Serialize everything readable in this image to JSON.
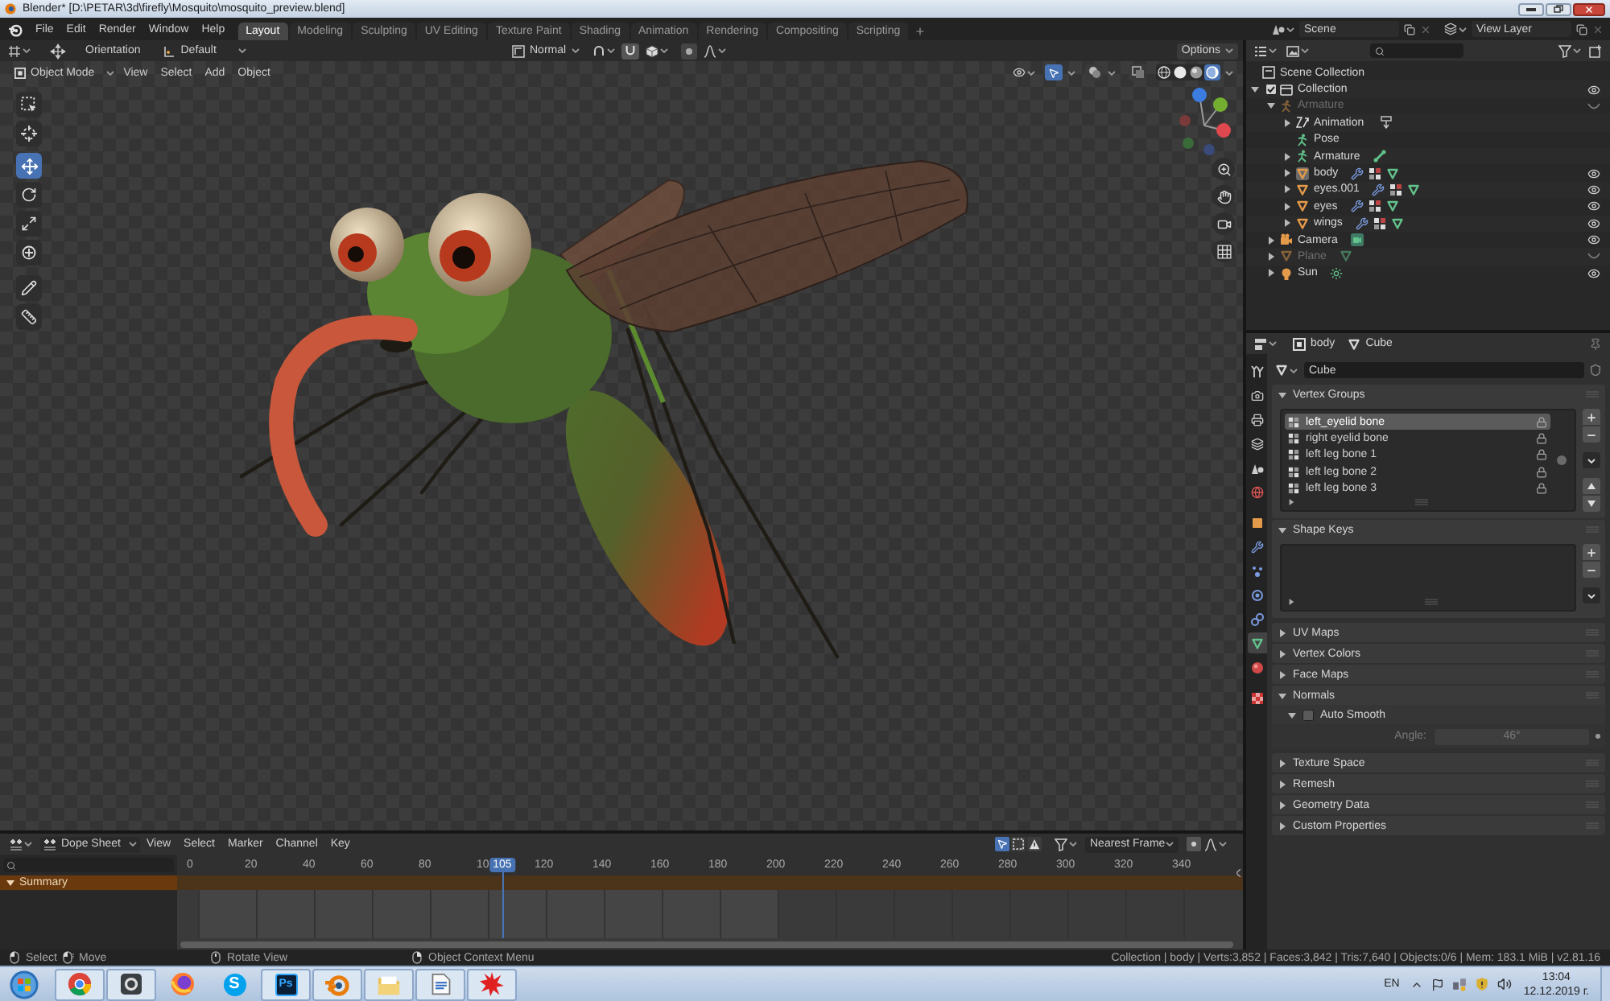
{
  "window": {
    "title": "Blender* [D:\\PETAR\\3d\\firefly\\Mosquito\\mosquito_preview.blend]"
  },
  "menu_bar": {
    "menus": [
      "File",
      "Edit",
      "Render",
      "Window",
      "Help"
    ],
    "workspaces": [
      {
        "label": "Layout",
        "selected": true
      },
      {
        "label": "Modeling",
        "selected": false
      },
      {
        "label": "Sculpting",
        "selected": false
      },
      {
        "label": "UV Editing",
        "selected": false
      },
      {
        "label": "Texture Paint",
        "selected": false
      },
      {
        "label": "Shading",
        "selected": false
      },
      {
        "label": "Animation",
        "selected": false
      },
      {
        "label": "Rendering",
        "selected": false
      },
      {
        "label": "Compositing",
        "selected": false
      },
      {
        "label": "Scripting",
        "selected": false
      }
    ],
    "scene": "Scene",
    "view_layer": "View Layer"
  },
  "tool_settings": {
    "orientation": "Orientation",
    "pivot": "Default",
    "transform": "Normal",
    "options": "Options"
  },
  "viewport": {
    "mode": "Object Mode",
    "menus": [
      "View",
      "Select",
      "Add",
      "Object"
    ],
    "gizmos_on": true,
    "overlays_on": false,
    "xray_on": false,
    "shading": [
      {
        "selected": false
      },
      {
        "selected": false
      },
      {
        "selected": false
      },
      {
        "selected": true
      }
    ],
    "tools": [
      {
        "selected": false
      },
      {
        "selected": false
      },
      {
        "selected": true
      },
      {
        "selected": false
      },
      {
        "selected": false
      },
      {
        "selected": false
      },
      {
        "selected": false
      },
      {
        "selected": false
      }
    ]
  },
  "outliner": {
    "root": "Scene Collection",
    "tree": [
      {
        "name": "Collection",
        "kind": "collection",
        "expanded": true,
        "checked": true,
        "visible": true,
        "children": [
          {
            "name": "Armature",
            "kind": "armature",
            "expanded": true,
            "visible": false,
            "active": false,
            "children": [
              {
                "name": "Animation",
                "kind": "action",
                "expanded": false
              },
              {
                "name": "Pose",
                "kind": "pose"
              },
              {
                "name": "Armature",
                "kind": "armature-data",
                "expanded": false
              },
              {
                "name": "body",
                "kind": "rigged-mesh",
                "expanded": false,
                "visible": true,
                "active": true
              },
              {
                "name": "eyes.001",
                "kind": "rigged-mesh",
                "expanded": false,
                "visible": true,
                "active": false
              },
              {
                "name": "eyes",
                "kind": "rigged-mesh",
                "expanded": false,
                "visible": true,
                "active": false
              },
              {
                "name": "wings",
                "kind": "rigged-mesh",
                "expanded": false,
                "visible": true,
                "active": false
              }
            ]
          },
          {
            "name": "Camera",
            "kind": "camera",
            "expanded": false,
            "visible": true,
            "active": false
          },
          {
            "name": "Plane",
            "kind": "mesh",
            "expanded": false,
            "visible": false,
            "active": false
          },
          {
            "name": "Sun",
            "kind": "light",
            "expanded": false,
            "visible": true,
            "active": false
          }
        ]
      }
    ]
  },
  "properties": {
    "object": "body",
    "data": "Cube",
    "mesh": "Cube",
    "tabs": [
      {
        "selected": false
      },
      {
        "selected": false
      },
      {
        "selected": false
      },
      {
        "selected": false
      },
      {
        "selected": false
      },
      {
        "selected": false
      },
      {
        "selected": false
      },
      {
        "selected": false
      },
      {
        "selected": false
      },
      {
        "selected": false
      },
      {
        "selected": false
      },
      {
        "selected": true
      },
      {
        "selected": false
      },
      {
        "selected": false
      }
    ],
    "panels": [
      {
        "title": "Vertex Groups",
        "kind": "vertex-groups",
        "expanded": true,
        "items": [
          {
            "name": "left_eyelid bone",
            "selected": true
          },
          {
            "name": "right eyelid bone",
            "selected": false
          },
          {
            "name": "left leg bone 1",
            "selected": false
          },
          {
            "name": "left leg bone 2",
            "selected": false
          },
          {
            "name": "left leg bone 3",
            "selected": false
          }
        ]
      },
      {
        "title": "Shape Keys",
        "kind": "shape-keys",
        "expanded": true
      },
      {
        "title": "UV Maps",
        "expanded": false
      },
      {
        "title": "Vertex Colors",
        "expanded": false
      },
      {
        "title": "Face Maps",
        "expanded": false
      },
      {
        "title": "Normals",
        "kind": "normals",
        "expanded": true,
        "auto_smooth": {
          "label": "Auto Smooth",
          "checked": false,
          "expanded": true
        },
        "angle": {
          "label": "Angle:",
          "value": "46°"
        }
      },
      {
        "title": "Texture Space",
        "expanded": false
      },
      {
        "title": "Remesh",
        "expanded": false
      },
      {
        "title": "Geometry Data",
        "expanded": false
      },
      {
        "title": "Custom Properties",
        "expanded": false
      }
    ]
  },
  "dope_sheet": {
    "mode": "Dope Sheet",
    "menus": [
      "View",
      "Select",
      "Marker",
      "Channel",
      "Key"
    ],
    "filters": [
      {
        "on": true
      },
      {
        "on": false
      },
      {
        "on": false
      }
    ],
    "snapping": "Nearest Frame",
    "ruler": [
      "0",
      "20",
      "40",
      "60",
      "80",
      "10",
      "120",
      "140",
      "160",
      "180",
      "200",
      "220",
      "240",
      "260",
      "280",
      "300",
      "320",
      "340"
    ],
    "current_frame": "105",
    "level": 0.305,
    "channels": [
      {
        "name": "Summary",
        "expanded": true
      }
    ]
  },
  "status_bar": {
    "hints": [
      {
        "kind": "left-click",
        "text": "Select"
      },
      {
        "kind": "left-drag",
        "text": "Move"
      },
      {
        "kind": "middle-click",
        "text": "Rotate View"
      },
      {
        "kind": "right-click",
        "text": "Object Context Menu"
      }
    ],
    "stats": "Collection | body | Verts:3,852 | Faces:3,842 | Tris:7,640 | Objects:0/6 | Mem: 183.1 MiB | v2.81.16"
  },
  "taskbar": {
    "apps": [
      {
        "kind": "chrome",
        "running": true
      },
      {
        "kind": "generic",
        "running": true
      },
      {
        "kind": "firefox",
        "running": false
      },
      {
        "kind": "skype",
        "label": "S",
        "running": false
      },
      {
        "kind": "photoshop",
        "label": "Ps",
        "running": true
      },
      {
        "kind": "blender",
        "running": true
      },
      {
        "kind": "folder",
        "running": true
      },
      {
        "kind": "document",
        "running": true
      },
      {
        "kind": "splat",
        "running": true
      }
    ],
    "language": "EN",
    "time": "13:04",
    "date": "12.12.2019 г."
  }
}
